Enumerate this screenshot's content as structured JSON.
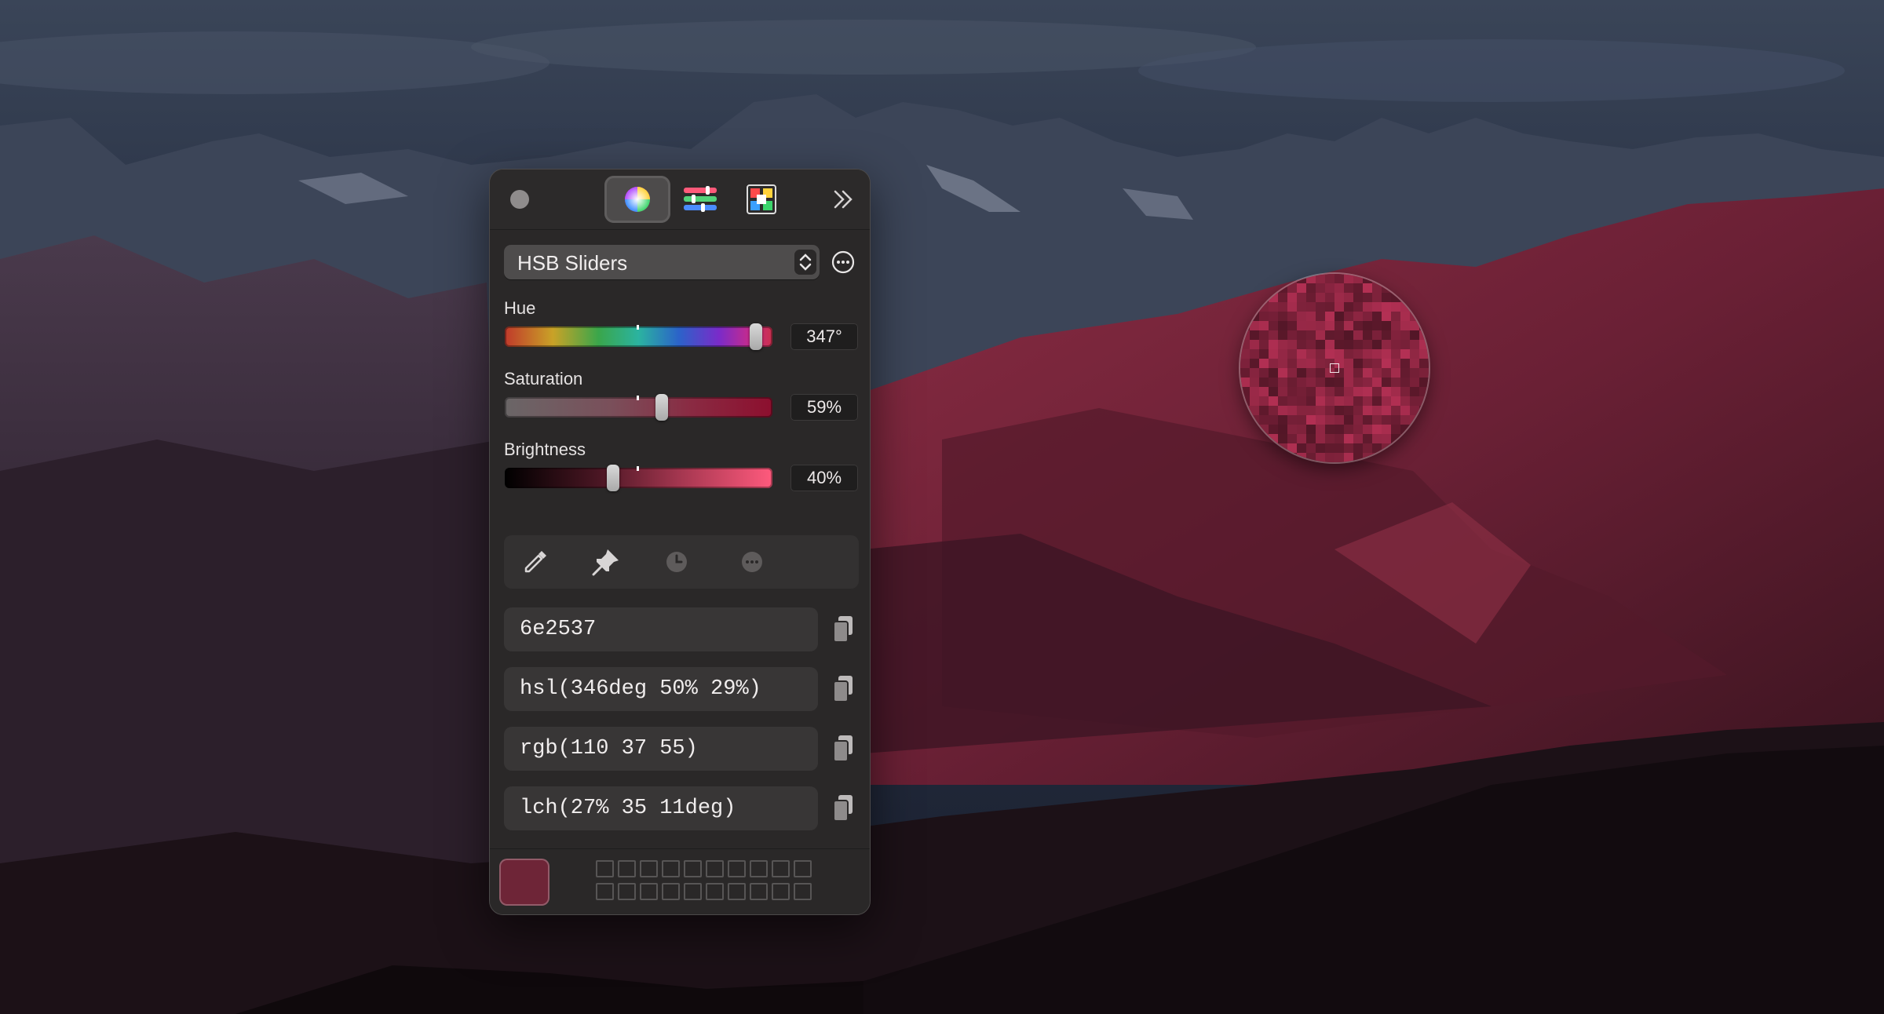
{
  "panel": {
    "tabs": [
      {
        "name": "color-wheel-tab",
        "icon": "color-wheel-icon",
        "active": true
      },
      {
        "name": "sliders-tab",
        "icon": "sliders-icon",
        "active": false
      },
      {
        "name": "palettes-tab",
        "icon": "palettes-icon",
        "active": false
      }
    ],
    "mode_select": {
      "label": "HSB Sliders"
    },
    "sliders": {
      "hue": {
        "label": "Hue",
        "value": "347°",
        "fraction": 0.96
      },
      "saturation": {
        "label": "Saturation",
        "value": "59%",
        "fraction": 0.59
      },
      "brightness": {
        "label": "Brightness",
        "value": "40%",
        "fraction": 0.4
      }
    },
    "tools": [
      "eyedropper-icon",
      "pin-icon",
      "history-icon",
      "more-icon"
    ],
    "codes": {
      "hex": "6e2537",
      "hsl": "hsl(346deg 50% 29%)",
      "rgb": "rgb(110 37 55)",
      "lch": "lch(27% 35 11deg)"
    },
    "current_color": "#6e2537",
    "swatch_slots": 20
  },
  "colors": {
    "panel_bg": "#2a2828",
    "accent": "#6e2537"
  }
}
